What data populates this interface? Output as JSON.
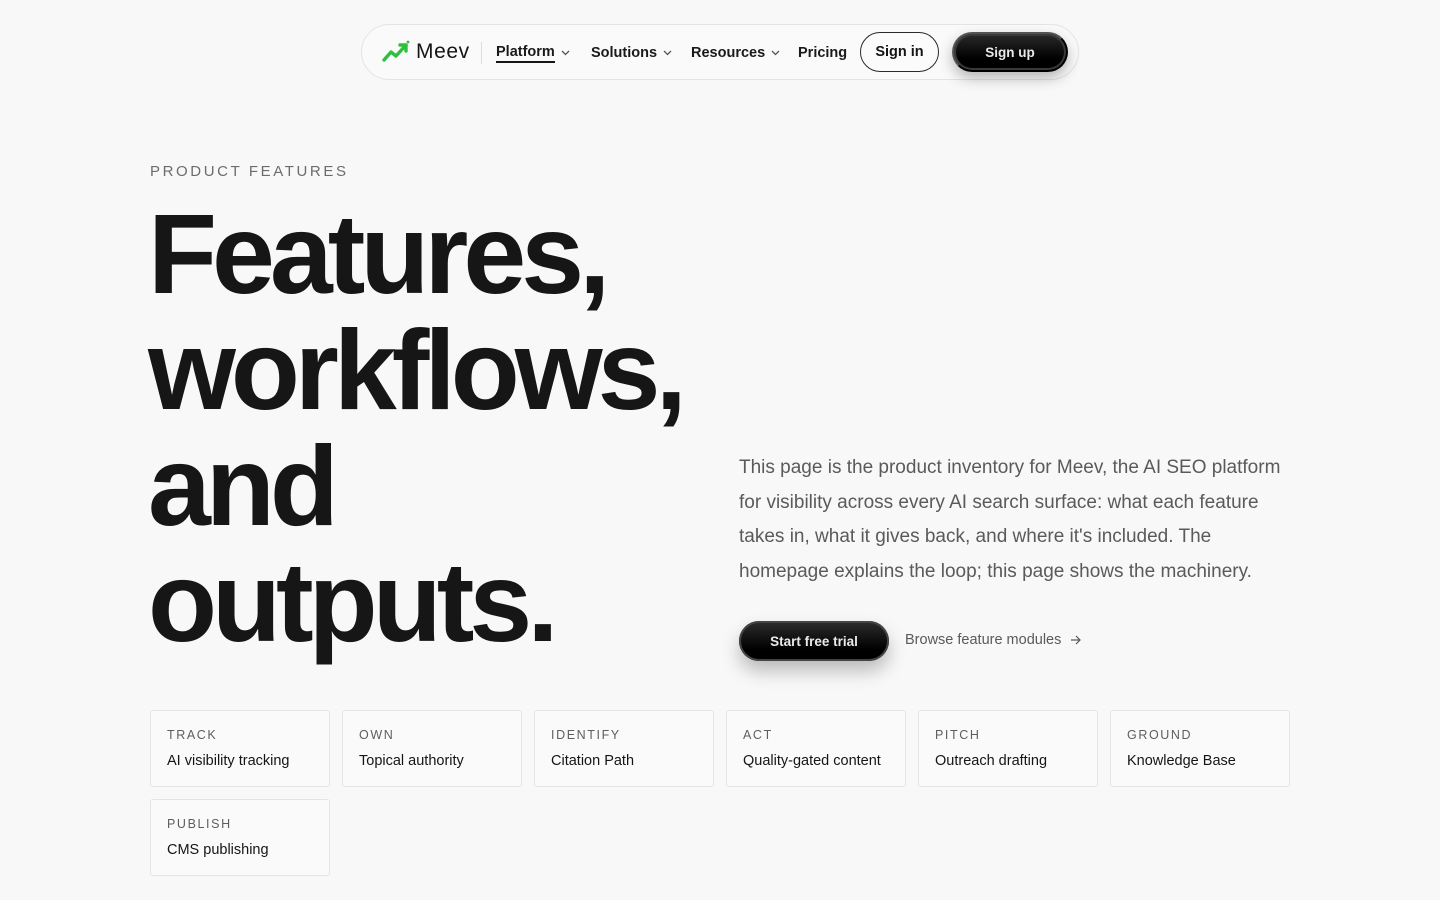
{
  "nav": {
    "brand": "Meev",
    "items": [
      {
        "label": "Platform"
      },
      {
        "label": "Solutions"
      },
      {
        "label": "Resources"
      },
      {
        "label": "Pricing"
      }
    ],
    "sign_in": "Sign in",
    "sign_up": "Sign up",
    "active_item": "Platform"
  },
  "hero": {
    "eyebrow": "PRODUCT FEATURES",
    "headline": [
      "Features,",
      "workflows,",
      "and",
      "outputs."
    ],
    "lede": "This page is the product inventory for Meev, the AI SEO platform for visibility across every AI search surface: what each feature takes in, what it gives back, and where it's included. The homepage explains the loop; this page shows the machinery.",
    "primary_cta": "Start free trial",
    "secondary_cta": "Browse feature modules"
  },
  "features": [
    {
      "key": "TRACK",
      "value": "AI visibility tracking"
    },
    {
      "key": "OWN",
      "value": "Topical authority"
    },
    {
      "key": "IDENTIFY",
      "value": "Citation Path"
    },
    {
      "key": "ACT",
      "value": "Quality-gated content"
    },
    {
      "key": "PITCH",
      "value": "Outreach drafting"
    },
    {
      "key": "GROUND",
      "value": "Knowledge Base"
    },
    {
      "key": "PUBLISH",
      "value": "CMS publishing"
    }
  ],
  "colors": {
    "background": "#f8f8f8",
    "text": "#151515",
    "muted": "#5a5a5a",
    "logo_green": "#2fbf3f",
    "button_dark": "#000000"
  },
  "icons": [
    "trend-up-logo-icon",
    "chevron-down-icon",
    "arrow-right-icon"
  ]
}
